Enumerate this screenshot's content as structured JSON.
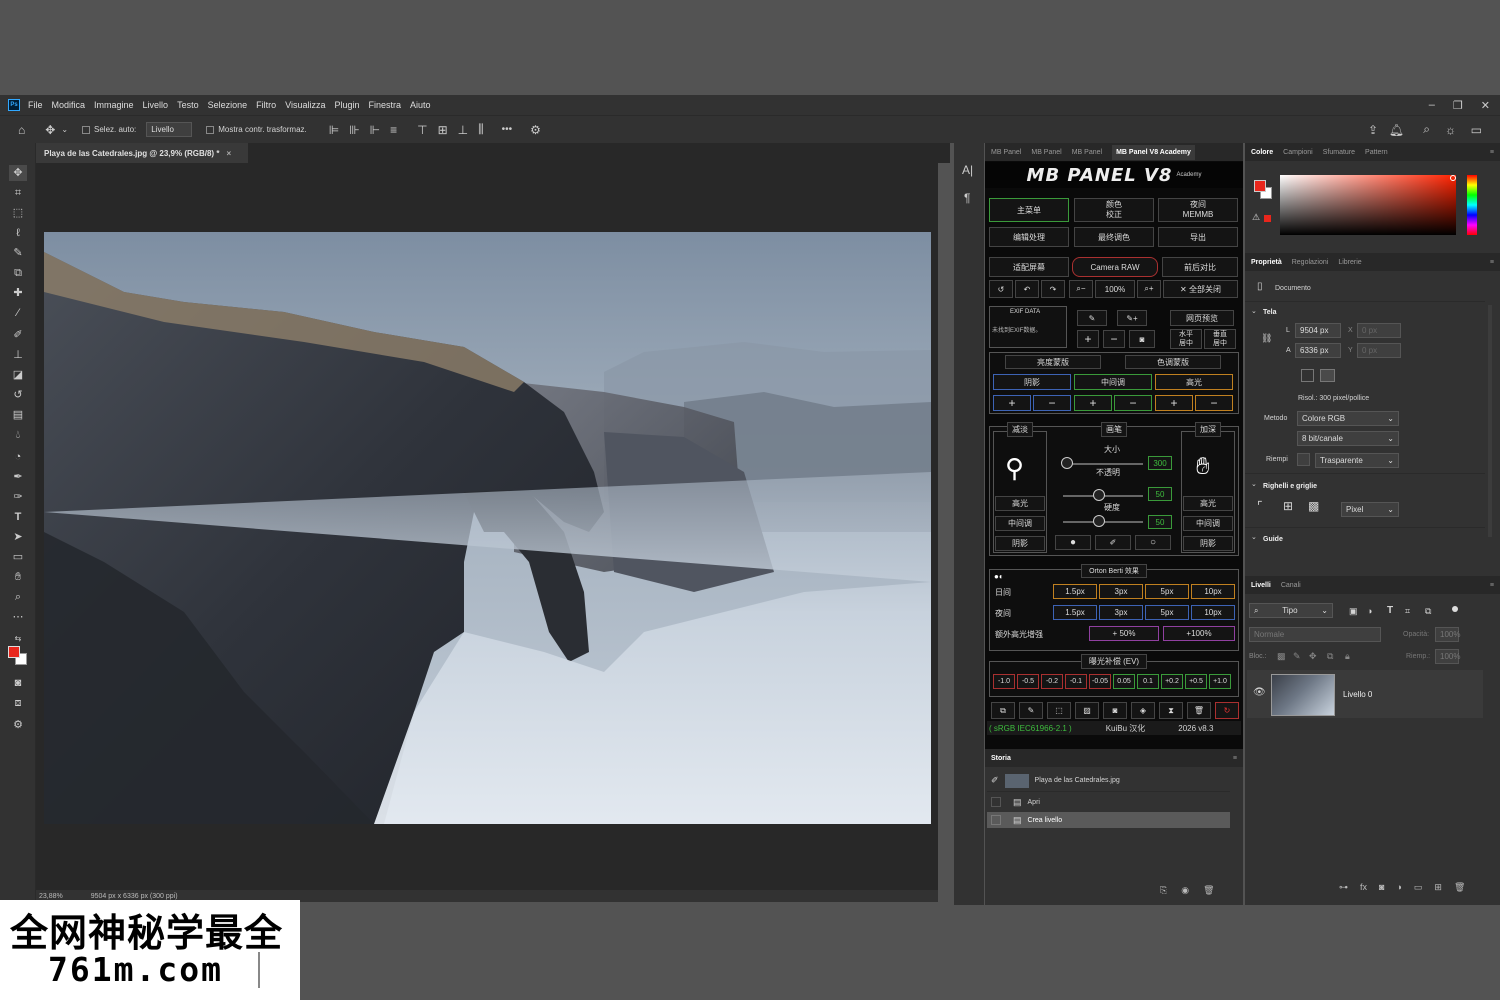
{
  "menu": [
    "File",
    "Modifica",
    "Immagine",
    "Livello",
    "Testo",
    "Selezione",
    "Filtro",
    "Visualizza",
    "Plugin",
    "Finestra",
    "Aiuto"
  ],
  "app_icon": "Ps",
  "window_controls": [
    "–",
    "❐",
    "✕"
  ],
  "options": {
    "auto_select_label": "Selez. auto:",
    "auto_select_value": "Livello",
    "transform_label": "Mostra contr. trasformaz.",
    "more": "•••"
  },
  "document": {
    "tab": "Playa de las Catedrales.jpg @ 23,9% (RGB/8) *",
    "close": "×",
    "zoom": "23,88%",
    "info": "9504 px x 6336 px (300 ppi)"
  },
  "mb": {
    "tabs": [
      "MB Panel",
      "MB Panel",
      "MB Panel",
      "MB Panel V8 Academy"
    ],
    "logo": "MB PANEL V8",
    "logo_sub": "Academy",
    "row1": [
      "主菜单",
      "颜色\n校正",
      "夜间\nMEMMB"
    ],
    "row2": [
      "编辑处理",
      "最终调色",
      "导出"
    ],
    "row3": [
      "适配屏幕",
      "Camera RAW",
      "前后对比"
    ],
    "zoom": "100%",
    "close_all": "✕ 全部关闭",
    "exif": "EXIF DATA",
    "exif_sub": "未找到EXIF数据。",
    "web_preview": "网页预览",
    "h_center": "水平\n居中",
    "v_center": "垂直\n居中",
    "luma_mask": "亮度蒙版",
    "color_mask": "色调蒙版",
    "tones": [
      "阴影",
      "中间调",
      "高光"
    ],
    "dodge": "减淡",
    "brush": "画笔",
    "burn": "加深",
    "size_label": "大小",
    "opacity_label": "不透明",
    "hardness_label": "硬度",
    "size_val": "300",
    "opacity_val": "50",
    "hardness_val": "50",
    "dodge_opts": [
      "高光",
      "中间调",
      "阴影"
    ],
    "burn_opts": [
      "高光",
      "中间调",
      "阴影"
    ],
    "orton": "Orton Berti 效果",
    "day": "日间",
    "night": "夜间",
    "orton_vals": [
      "1.5px",
      "3px",
      "5px",
      "10px"
    ],
    "extra_hl": "额外高光增强",
    "plus50": "+ 50%",
    "plus100": "+100%",
    "ev_title": "曝光补偿 (EV)",
    "ev": [
      "-1.0",
      "-0.5",
      "-0.2",
      "-0.1",
      "-0.05",
      "0.05",
      "0.1",
      "+0.2",
      "+0.5",
      "+1.0"
    ],
    "srgb": "( sRGB IEC61966-2.1 )",
    "credit": "KuiBu 汉化",
    "version": "2026 v8.3"
  },
  "history": {
    "title": "Storia",
    "items": [
      "Playa de las Catedrales.jpg",
      "Apri",
      "Crea livello"
    ]
  },
  "color_tabs": [
    "Colore",
    "Campioni",
    "Sfumature",
    "Pattern"
  ],
  "colors": {
    "fg": "#e8261c",
    "bg": "#ffffff",
    "accent": "#31a8ff"
  },
  "props_tabs": [
    "Proprietà",
    "Regolazioni",
    "Librerie"
  ],
  "props": {
    "doc": "Documento",
    "canvas": "Tela",
    "w_label": "L",
    "w": "9504 px",
    "h_label": "A",
    "h": "6336 px",
    "x_label": "X",
    "x": "0 px",
    "y_label": "Y",
    "y": "0 px",
    "res": "Risol.: 300 pixel/pollice",
    "mode_label": "Metodo",
    "mode": "Colore RGB",
    "depth": "8 bit/canale",
    "fill_label": "Riempi",
    "fill": "Trasparente",
    "rulers": "Righelli e griglie",
    "unit": "Pixel",
    "guides": "Guide"
  },
  "layers_tabs": [
    "Livelli",
    "Canali"
  ],
  "layers": {
    "kind": "Tipo",
    "blend": "Normale",
    "opacity_label": "Opacità:",
    "opacity": "100%",
    "lock_label": "Bloc.:",
    "fill_label": "Riemp.:",
    "fill": "100%",
    "layer": "Livello 0"
  },
  "watermark": {
    "line1": "全网神秘学最全",
    "line2": "761m.com"
  }
}
